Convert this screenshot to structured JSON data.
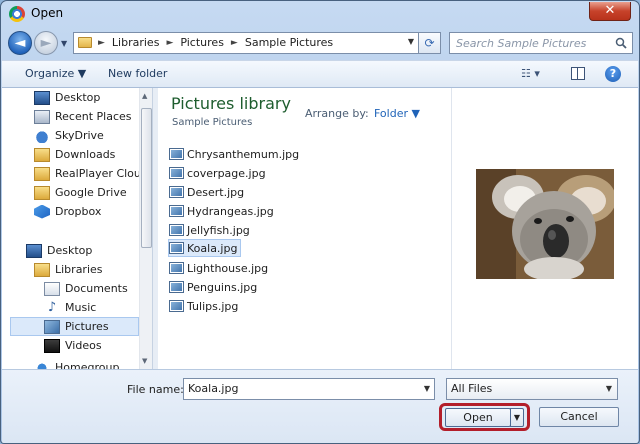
{
  "window": {
    "title": "Open",
    "close_glyph": "✕"
  },
  "nav": {
    "back_glyph": "◄",
    "forward_glyph": "►",
    "history_drop": "▼"
  },
  "address": {
    "crumbs": [
      "Libraries",
      "Pictures",
      "Sample Pictures"
    ],
    "separator": "►",
    "drop_glyph": "▼",
    "refresh_glyph": "⟳"
  },
  "search": {
    "placeholder": "Search Sample Pictures"
  },
  "toolbar": {
    "organize_label": "Organize ▼",
    "new_folder_label": "New folder",
    "view_glyph": "☷ ▾",
    "help_glyph": "?"
  },
  "sidebar": {
    "items": [
      {
        "label": "Desktop",
        "icon": "desktop-icon"
      },
      {
        "label": "Recent Places",
        "icon": "recent-places-icon"
      },
      {
        "label": "SkyDrive",
        "icon": "skydrive-icon"
      },
      {
        "label": "Downloads",
        "icon": "downloads-icon"
      },
      {
        "label": "RealPlayer Cloud",
        "icon": "realplayer-icon"
      },
      {
        "label": "Google Drive",
        "icon": "google-drive-icon"
      },
      {
        "label": "Dropbox",
        "icon": "dropbox-icon"
      },
      {
        "label": "Desktop",
        "icon": "desktop-icon"
      },
      {
        "label": "Libraries",
        "icon": "libraries-icon"
      },
      {
        "label": "Documents",
        "icon": "documents-icon"
      },
      {
        "label": "Music",
        "icon": "music-icon"
      },
      {
        "label": "Pictures",
        "icon": "pictures-icon",
        "selected": true
      },
      {
        "label": "Videos",
        "icon": "videos-icon"
      },
      {
        "label": "Homegroup",
        "icon": "homegroup-icon"
      }
    ]
  },
  "library": {
    "title": "Pictures library",
    "subtitle": "Sample Pictures",
    "arrange_label": "Arrange by:",
    "arrange_value": "Folder ▼"
  },
  "files": [
    {
      "name": "Chrysanthemum.jpg"
    },
    {
      "name": "coverpage.jpg"
    },
    {
      "name": "Desert.jpg"
    },
    {
      "name": "Hydrangeas.jpg"
    },
    {
      "name": "Jellyfish.jpg"
    },
    {
      "name": "Koala.jpg",
      "selected": true
    },
    {
      "name": "Lighthouse.jpg"
    },
    {
      "name": "Penguins.jpg"
    },
    {
      "name": "Tulips.jpg"
    }
  ],
  "footer": {
    "filename_label": "File name:",
    "filename_value": "Koala.jpg",
    "filter_value": "All Files",
    "drop_glyph": "▼",
    "open_label": "Open",
    "cancel_label": "Cancel"
  },
  "colors": {
    "highlight_outline": "#b31e2a",
    "selection": "#dbe9fa",
    "library_title": "#1e5d2e"
  }
}
